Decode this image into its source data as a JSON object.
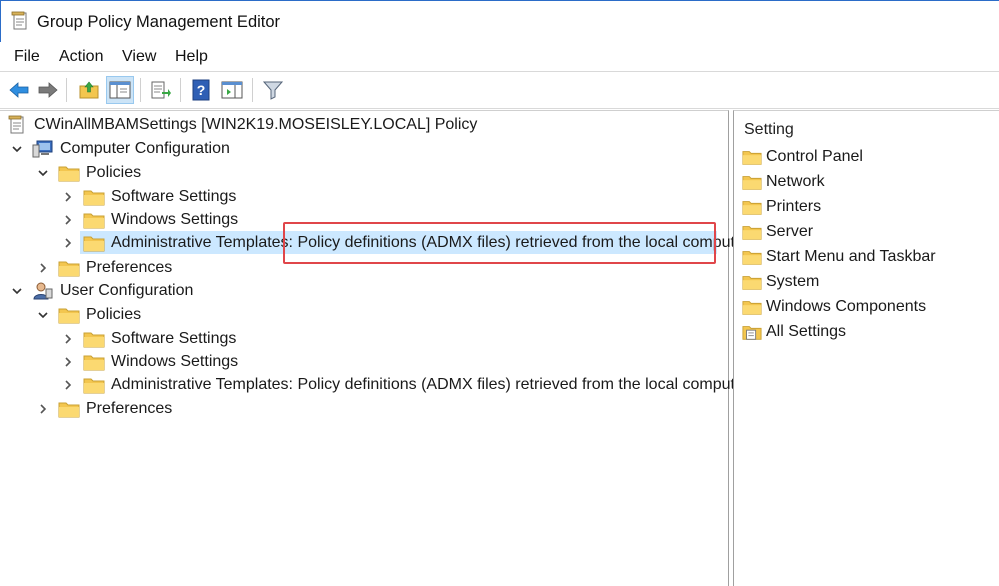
{
  "window": {
    "title": "Group Policy Management Editor",
    "accent_color": "#2b6cc8"
  },
  "menu": [
    "File",
    "Action",
    "View",
    "Help"
  ],
  "toolbar": {
    "buttons": [
      "back-arrow-icon",
      "forward-arrow-icon",
      "up-folder-icon",
      "show-hide-tree-icon",
      "export-list-icon",
      "help-icon",
      "show-action-pane-icon",
      "filter-icon"
    ]
  },
  "tree": {
    "root": "CWinAllMBAMSettings [WIN2K19.MOSEISLEY.LOCAL] Policy",
    "computer_config": {
      "label": "Computer Configuration",
      "policies": "Policies",
      "software": "Software Settings",
      "windows": "Windows Settings",
      "admin_prefix": "Administrative Templates: ",
      "admin_suffix": "Policy definitions (ADMX files) retrieved from the local computer.",
      "preferences": "Preferences"
    },
    "user_config": {
      "label": "User Configuration",
      "policies": "Policies",
      "software": "Software Settings",
      "windows": "Windows Settings",
      "admin_label": "Administrative Templates: Policy definitions (ADMX files) retrieved from the local computer.",
      "preferences": "Preferences"
    }
  },
  "right_pane": {
    "header": "Setting",
    "items": [
      "Control Panel",
      "Network",
      "Printers",
      "Server",
      "Start Menu and Taskbar",
      "System",
      "Windows Components",
      "All Settings"
    ]
  },
  "colors": {
    "selection": "#cce8ff",
    "highlight_border": "#e0464a",
    "folder": "#f3c64f"
  }
}
